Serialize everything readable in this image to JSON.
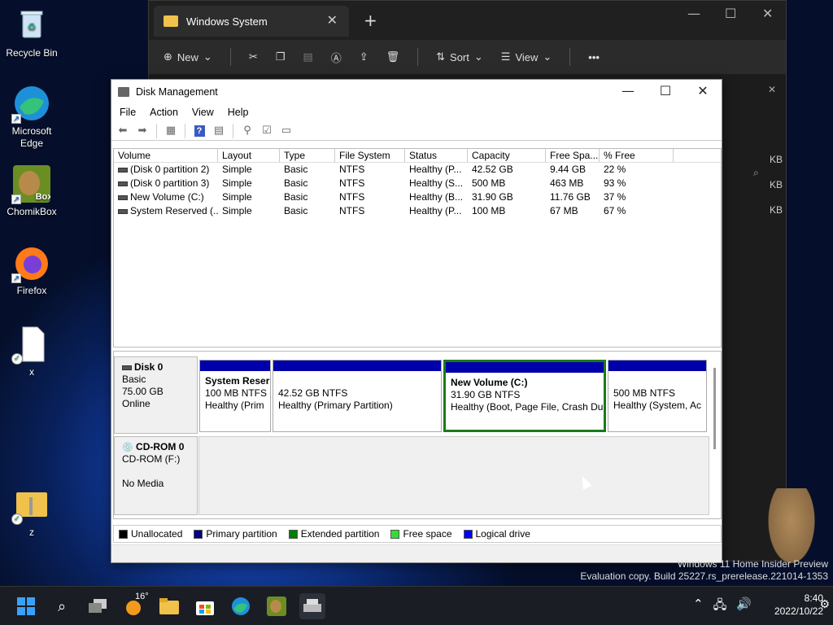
{
  "desktop": {
    "icons": [
      {
        "label": "Recycle Bin"
      },
      {
        "label": "Microsoft Edge"
      },
      {
        "label": "ChomikBox"
      },
      {
        "label": "Firefox"
      },
      {
        "label": "x"
      },
      {
        "label": "z"
      }
    ]
  },
  "explorer": {
    "tab_title": "Windows System",
    "toolbar": {
      "new_label": "New",
      "sort_label": "Sort",
      "view_label": "View"
    },
    "side_sizes": [
      "KB",
      "KB",
      "KB"
    ]
  },
  "dm": {
    "title": "Disk Management",
    "menu": [
      "File",
      "Action",
      "View",
      "Help"
    ],
    "columns": [
      "Volume",
      "Layout",
      "Type",
      "File System",
      "Status",
      "Capacity",
      "Free Spa...",
      "% Free"
    ],
    "rows": [
      [
        "(Disk 0 partition 2)",
        "Simple",
        "Basic",
        "NTFS",
        "Healthy (P...",
        "42.52 GB",
        "9.44 GB",
        "22 %"
      ],
      [
        "(Disk 0 partition 3)",
        "Simple",
        "Basic",
        "NTFS",
        "Healthy (S...",
        "500 MB",
        "463 MB",
        "93 %"
      ],
      [
        "New Volume (C:)",
        "Simple",
        "Basic",
        "NTFS",
        "Healthy (B...",
        "31.90 GB",
        "11.76 GB",
        "37 %"
      ],
      [
        "System Reserved (...",
        "Simple",
        "Basic",
        "NTFS",
        "Healthy (P...",
        "100 MB",
        "67 MB",
        "67 %"
      ]
    ],
    "disk0": {
      "name": "Disk 0",
      "type": "Basic",
      "size": "75.00 GB",
      "state": "Online",
      "partitions": [
        {
          "name": "System Reser",
          "size": "100 MB NTFS",
          "status": "Healthy (Prim"
        },
        {
          "name": "",
          "size": "42.52 GB NTFS",
          "status": "Healthy (Primary Partition)"
        },
        {
          "name": "New Volume  (C:)",
          "size": "31.90 GB NTFS",
          "status": "Healthy (Boot, Page File, Crash Du"
        },
        {
          "name": "",
          "size": "500 MB NTFS",
          "status": "Healthy (System, Ac"
        }
      ]
    },
    "cdrom0": {
      "name": "CD-ROM 0",
      "drive": "CD-ROM (F:)",
      "media": "No Media"
    },
    "legend": [
      {
        "label": "Unallocated",
        "color": "#000000"
      },
      {
        "label": "Primary partition",
        "color": "#000080"
      },
      {
        "label": "Extended partition",
        "color": "#008000"
      },
      {
        "label": "Free space",
        "color": "#33dd33"
      },
      {
        "label": "Logical drive",
        "color": "#0000ff"
      }
    ]
  },
  "watermark": {
    "line1": "Windows 11 Home Insider Preview",
    "line2": "Evaluation copy. Build 25227.rs_prerelease.221014-1353"
  },
  "taskbar": {
    "weather": "16°",
    "time": "8:40",
    "date": "2022/10/22"
  }
}
